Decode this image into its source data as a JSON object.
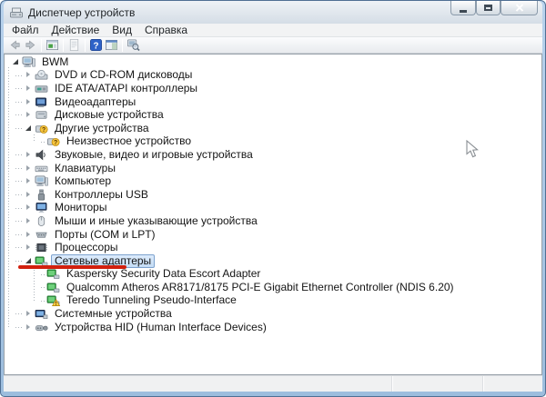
{
  "window": {
    "title": "Диспетчер устройств"
  },
  "titlebar": {
    "buttons": [
      "minimize",
      "maximize",
      "close"
    ]
  },
  "menu": {
    "items": [
      {
        "label": "Файл"
      },
      {
        "label": "Действие"
      },
      {
        "label": "Вид"
      },
      {
        "label": "Справка"
      }
    ]
  },
  "toolbar": {
    "icons": [
      "back",
      "forward",
      "show-console-tree",
      "properties",
      "help",
      "show-action-pane",
      "scan-hardware-changes"
    ]
  },
  "tree": {
    "items": [
      {
        "label": "BWM",
        "level": 0,
        "state": "expanded",
        "icon": "computer-icon"
      },
      {
        "label": "DVD и CD-ROM дисководы",
        "level": 1,
        "state": "collapsed",
        "icon": "cd-drive-icon"
      },
      {
        "label": "IDE ATA/ATAPI контроллеры",
        "level": 1,
        "state": "collapsed",
        "icon": "ide-controller-icon"
      },
      {
        "label": "Видеоадаптеры",
        "level": 1,
        "state": "collapsed",
        "icon": "video-adapter-icon"
      },
      {
        "label": "Дисковые устройства",
        "level": 1,
        "state": "collapsed",
        "icon": "disk-drive-icon"
      },
      {
        "label": "Другие устройства",
        "level": 1,
        "state": "expanded",
        "icon": "unknown-device-icon"
      },
      {
        "label": "Неизвестное устройство",
        "level": 2,
        "state": "leaf",
        "icon": "unknown-device-icon"
      },
      {
        "label": "Звуковые, видео и игровые устройства",
        "level": 1,
        "state": "collapsed",
        "icon": "speaker-icon"
      },
      {
        "label": "Клавиатуры",
        "level": 1,
        "state": "collapsed",
        "icon": "keyboard-icon"
      },
      {
        "label": "Компьютер",
        "level": 1,
        "state": "collapsed",
        "icon": "computer-icon"
      },
      {
        "label": "Контроллеры USB",
        "level": 1,
        "state": "collapsed",
        "icon": "usb-icon"
      },
      {
        "label": "Мониторы",
        "level": 1,
        "state": "collapsed",
        "icon": "monitor-icon"
      },
      {
        "label": "Мыши и иные указывающие устройства",
        "level": 1,
        "state": "collapsed",
        "icon": "mouse-icon"
      },
      {
        "label": "Порты (COM и LPT)",
        "level": 1,
        "state": "collapsed",
        "icon": "port-icon"
      },
      {
        "label": "Процессоры",
        "level": 1,
        "state": "collapsed",
        "icon": "cpu-icon"
      },
      {
        "label": "Сетевые адаптеры",
        "level": 1,
        "state": "expanded",
        "icon": "network-adapter-icon",
        "selected": true,
        "annotation": "red-underline"
      },
      {
        "label": "Kaspersky Security Data Escort Adapter",
        "level": 2,
        "state": "leaf",
        "icon": "network-adapter-icon"
      },
      {
        "label": "Qualcomm Atheros AR8171/8175 PCI-E Gigabit Ethernet Controller (NDIS 6.20)",
        "level": 2,
        "state": "leaf",
        "icon": "network-adapter-icon"
      },
      {
        "label": "Teredo Tunneling Pseudo-Interface",
        "level": 2,
        "state": "leaf",
        "icon": "network-adapter-warning-icon"
      },
      {
        "label": "Системные устройства",
        "level": 1,
        "state": "collapsed",
        "icon": "system-devices-icon"
      },
      {
        "label": "Устройства HID (Human Interface Devices)",
        "level": 1,
        "state": "collapsed",
        "icon": "hid-device-icon"
      }
    ]
  },
  "colors": {
    "selection_fill": "#cfe2f7",
    "selection_border": "#7da2ce",
    "red_underline": "#d2200e",
    "help_blue": "#2e62c8",
    "close_button_red": "#cf4a2e",
    "window_border_blue": "#9dbddd",
    "adapter_green": "#2f9e3f",
    "warning_yellow": "#f7c53d"
  }
}
